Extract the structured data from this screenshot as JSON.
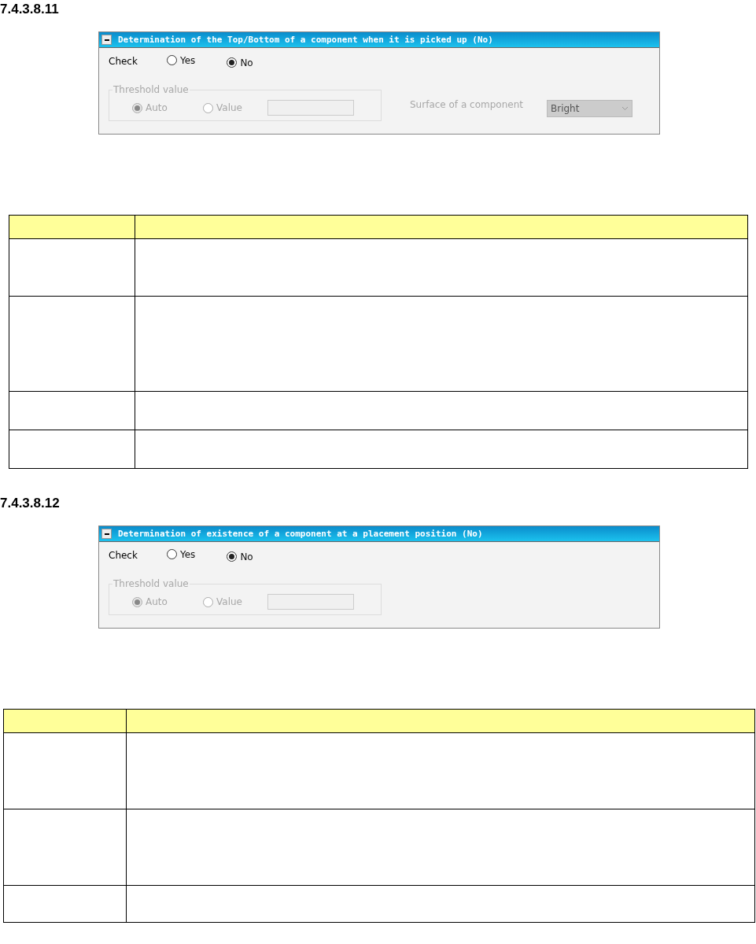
{
  "sections": [
    {
      "heading": "7.4.3.8.11",
      "panel": {
        "title": "Determination of the Top/Bottom of a component when it is picked up (No)",
        "check": {
          "label": "Check",
          "options": [
            {
              "label": "Yes",
              "selected": false
            },
            {
              "label": "No",
              "selected": true
            }
          ]
        },
        "threshold": {
          "legend": "Threshold value",
          "disabled": true,
          "options": [
            {
              "label": "Auto",
              "selected": true
            },
            {
              "label": "Value",
              "selected": false
            }
          ]
        },
        "surface": {
          "label": "Surface of a component",
          "value": "Bright",
          "disabled": true
        }
      }
    },
    {
      "heading": "7.4.3.8.12",
      "panel": {
        "title": "Determination of existence of a component at a placement position (No)",
        "check": {
          "label": "Check",
          "options": [
            {
              "label": "Yes",
              "selected": false
            },
            {
              "label": "No",
              "selected": true
            }
          ]
        },
        "threshold": {
          "legend": "Threshold value",
          "disabled": true,
          "options": [
            {
              "label": "Auto",
              "selected": true
            },
            {
              "label": "Value",
              "selected": false
            }
          ]
        }
      }
    }
  ]
}
